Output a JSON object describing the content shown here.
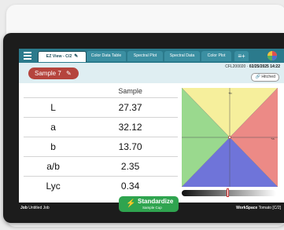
{
  "tabs": [
    {
      "label": "EZ View - C/2",
      "active": true
    },
    {
      "label": "Color Data Table",
      "active": false
    },
    {
      "label": "Spectral Plot",
      "active": false
    },
    {
      "label": "Spectral Data",
      "active": false
    },
    {
      "label": "Color Plot",
      "active": false
    }
  ],
  "sample": {
    "name": "Sample 7"
  },
  "meta": {
    "id": "CFL200020",
    "datetime": "02/25/2025 14:22"
  },
  "hitched_label": "Hitched",
  "table": {
    "header": "Sample",
    "rows": [
      {
        "label": "L",
        "value": "27.37"
      },
      {
        "label": "a",
        "value": "32.12"
      },
      {
        "label": "b",
        "value": "13.70"
      },
      {
        "label": "a/b",
        "value": "2.35"
      },
      {
        "label": "Lyc",
        "value": "0.34"
      }
    ]
  },
  "plot_labels": {
    "top": "+b",
    "right": "+a"
  },
  "standardize": {
    "label": "Standardize",
    "sublabel": "Sample Cup"
  },
  "footer": {
    "job": "Untitled Job",
    "workspace": "Tomato [C/2]"
  },
  "colors": {
    "header": "#2b7a8c",
    "sample_pill": "#b5443d",
    "standardize": "#2fa44f"
  }
}
